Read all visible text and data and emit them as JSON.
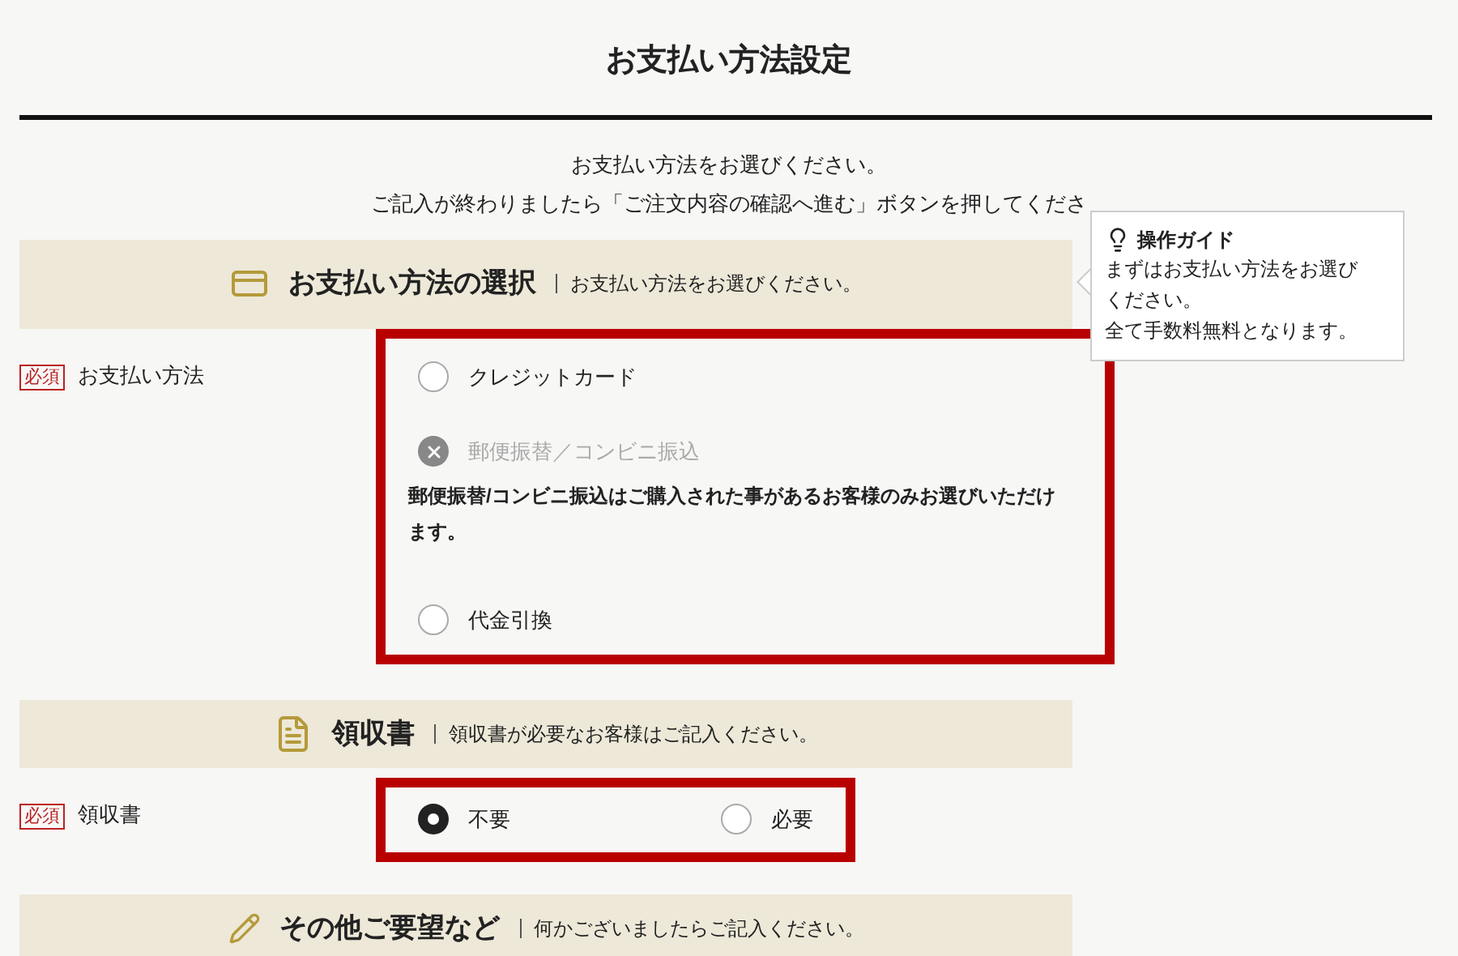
{
  "page_title": "お支払い方法設定",
  "instructions": [
    "お支払い方法をお選びください。",
    "ご記入が終わりましたら「ご注文内容の確認へ進む」ボタンを押してくださ"
  ],
  "guide": {
    "title": "操作ガイド",
    "lines": [
      "まずはお支払い方法をお選び",
      "ください。",
      "全て手数料無料となります。"
    ]
  },
  "sections": [
    {
      "kind": "card",
      "title": "お支払い方法の選択",
      "subtitle": "お支払い方法をお選びください。",
      "rows": [
        {
          "badge": "必須",
          "label": "お支払い方法",
          "kind": "stack",
          "options": [
            {
              "label": "クレジットカード",
              "selected": false,
              "disabled": false
            },
            {
              "label": "郵便振替／コンビニ振込",
              "disabled": true,
              "note": "郵便振替/コンビニ振込はご購入された事があるお客様のみお選びいただけます。"
            },
            {
              "label": "代金引換",
              "selected": false,
              "disabled": false
            }
          ]
        }
      ]
    },
    {
      "kind": "document",
      "title": "領収書",
      "subtitle": "領収書が必要なお客様はご記入ください。",
      "rows": [
        {
          "badge": "必須",
          "label": "領収書",
          "kind": "inline",
          "options": [
            {
              "label": "不要",
              "selected": true,
              "disabled": false
            },
            {
              "label": "必要",
              "selected": false,
              "disabled": false
            }
          ]
        }
      ]
    },
    {
      "kind": "pencil",
      "title": "その他ご要望など",
      "subtitle": "何かございましたらご記入ください。"
    }
  ]
}
